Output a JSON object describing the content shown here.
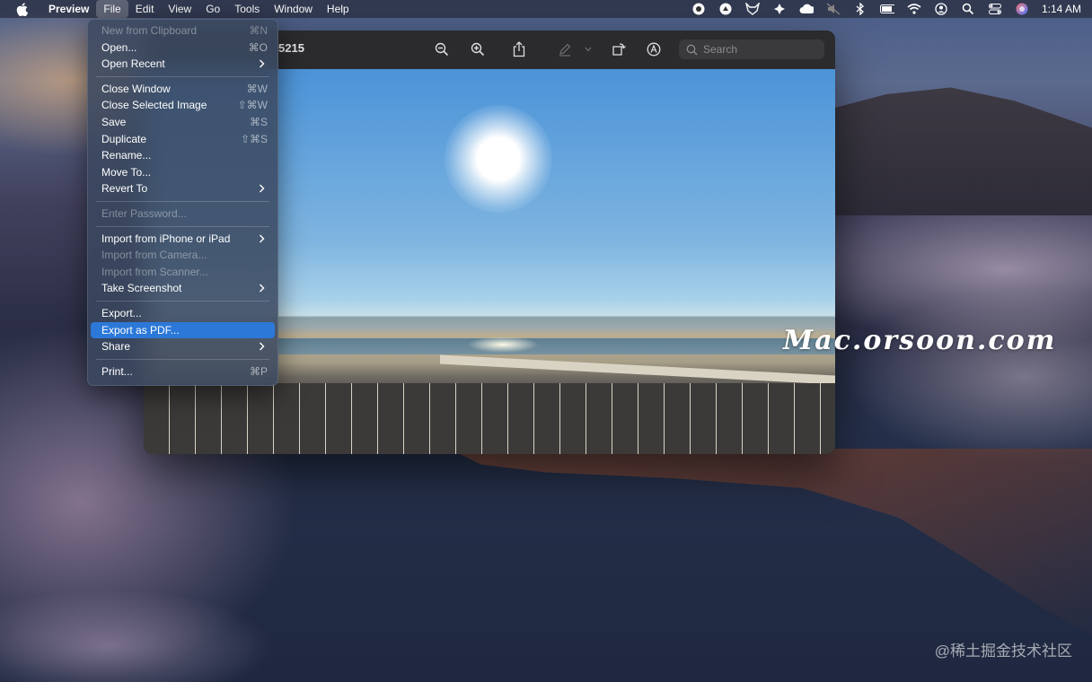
{
  "menubar": {
    "items": [
      "Preview",
      "File",
      "Edit",
      "View",
      "Go",
      "Tools",
      "Window",
      "Help"
    ],
    "active": "File",
    "clock": "1:14 AM"
  },
  "window": {
    "title_fragment": "5215",
    "search_placeholder": "Search"
  },
  "file_menu": {
    "new_from_clipboard": {
      "label": "New from Clipboard",
      "shortcut": "⌘N"
    },
    "open": {
      "label": "Open...",
      "shortcut": "⌘O"
    },
    "open_recent": {
      "label": "Open Recent"
    },
    "close_window": {
      "label": "Close Window",
      "shortcut": "⌘W"
    },
    "close_selected_image": {
      "label": "Close Selected Image",
      "shortcut": "⇧⌘W"
    },
    "save": {
      "label": "Save",
      "shortcut": "⌘S"
    },
    "duplicate": {
      "label": "Duplicate",
      "shortcut": "⇧⌘S"
    },
    "rename": {
      "label": "Rename..."
    },
    "move_to": {
      "label": "Move To..."
    },
    "revert_to": {
      "label": "Revert To"
    },
    "enter_password": {
      "label": "Enter Password..."
    },
    "import_iphone": {
      "label": "Import from iPhone or iPad"
    },
    "import_camera": {
      "label": "Import from Camera..."
    },
    "import_scanner": {
      "label": "Import from Scanner..."
    },
    "take_screenshot": {
      "label": "Take Screenshot"
    },
    "export": {
      "label": "Export..."
    },
    "export_pdf": {
      "label": "Export as PDF..."
    },
    "share": {
      "label": "Share"
    },
    "print": {
      "label": "Print...",
      "shortcut": "⌘P"
    }
  },
  "overlays": {
    "watermark": "Mac.orsoon.com",
    "source_credit": "@稀土掘金技术社区"
  },
  "colors": {
    "highlight": "#2c78d8",
    "menu_bg": "#3a4860"
  }
}
